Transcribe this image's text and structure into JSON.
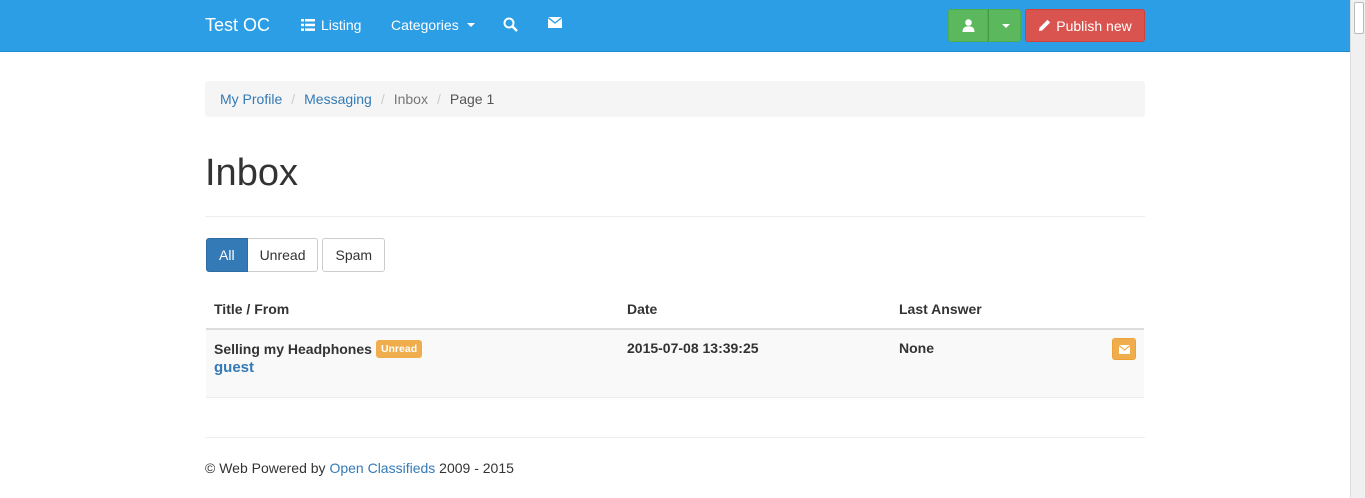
{
  "navbar": {
    "brand": "Test OC",
    "listing": "Listing",
    "categories": "Categories",
    "publish_label": "Publish new",
    "colors": {
      "navbar": "#2b9ee6",
      "user_button": "#5cb85c",
      "publish_button": "#d9534f"
    },
    "icons": [
      "list-icon",
      "search-icon",
      "envelope-icon",
      "user-icon",
      "caret-down-icon",
      "pencil-icon"
    ]
  },
  "breadcrumb": {
    "items": [
      "My Profile",
      "Messaging",
      "Inbox",
      "Page 1"
    ]
  },
  "page": {
    "title": "Inbox"
  },
  "filters": {
    "all": "All",
    "unread": "Unread",
    "spam": "Spam"
  },
  "table": {
    "headers": [
      "Title / From",
      "Date",
      "Last Answer"
    ],
    "rows": [
      {
        "title": "Selling my Headphones",
        "badge": "Unread",
        "from": "guest",
        "date": "2015-07-08 13:39:25",
        "last_answer": "None"
      }
    ]
  },
  "footer": {
    "prefix": "© Web Powered by",
    "link": "Open Classifieds",
    "suffix": "2009 - 2015"
  }
}
